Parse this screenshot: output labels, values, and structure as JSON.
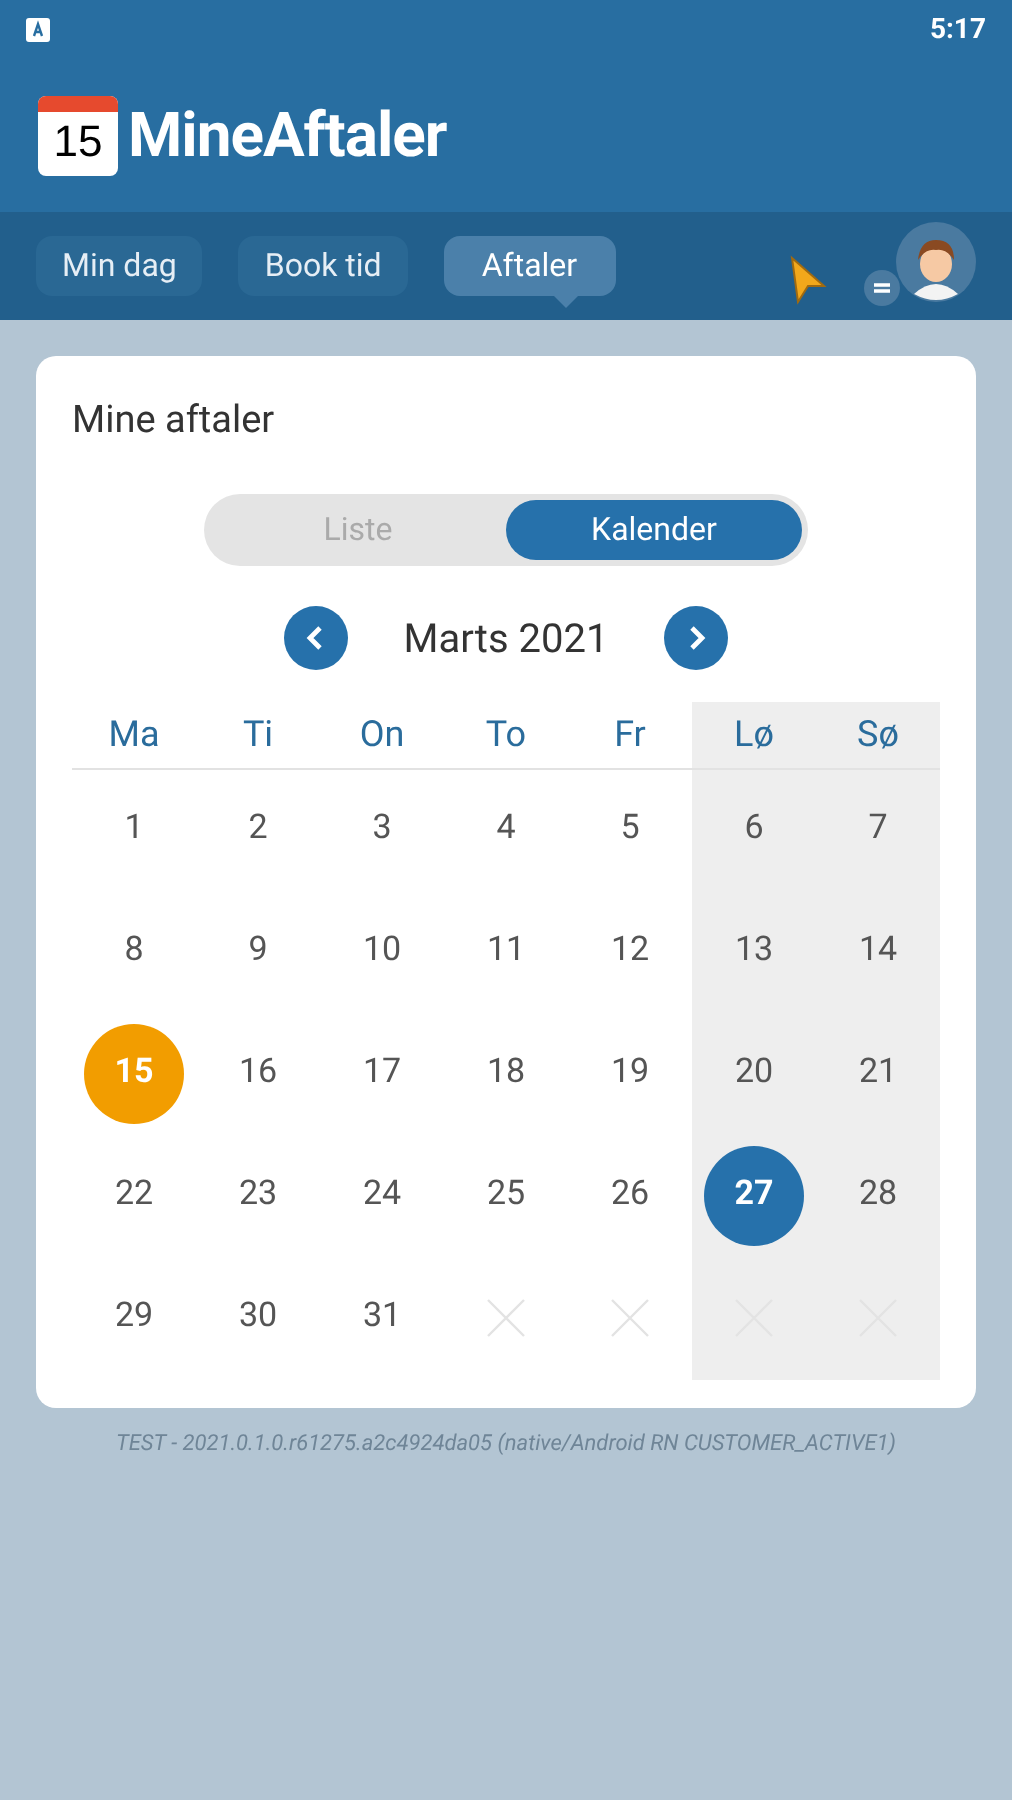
{
  "status_bar": {
    "time": "5:17"
  },
  "app": {
    "logo_day": "15",
    "title": "MineAftaler"
  },
  "tabs": [
    {
      "label": "Min dag",
      "selected": false
    },
    {
      "label": "Book tid",
      "selected": false
    },
    {
      "label": "Aftaler",
      "selected": true
    }
  ],
  "card": {
    "title": "Mine aftaler",
    "view_toggle": [
      {
        "label": "Liste",
        "selected": false
      },
      {
        "label": "Kalender",
        "selected": true
      }
    ],
    "month": "Marts 2021",
    "weekdays": [
      {
        "label": "Ma",
        "weekend": false
      },
      {
        "label": "Ti",
        "weekend": false
      },
      {
        "label": "On",
        "weekend": false
      },
      {
        "label": "To",
        "weekend": false
      },
      {
        "label": "Fr",
        "weekend": false
      },
      {
        "label": "Lø",
        "weekend": true
      },
      {
        "label": "Sø",
        "weekend": true
      }
    ],
    "days": [
      {
        "kind": "day",
        "label": "1"
      },
      {
        "kind": "day",
        "label": "2"
      },
      {
        "kind": "day",
        "label": "3"
      },
      {
        "kind": "day",
        "label": "4"
      },
      {
        "kind": "day",
        "label": "5"
      },
      {
        "kind": "day",
        "label": "6"
      },
      {
        "kind": "day",
        "label": "7"
      },
      {
        "kind": "day",
        "label": "8"
      },
      {
        "kind": "day",
        "label": "9"
      },
      {
        "kind": "day",
        "label": "10"
      },
      {
        "kind": "day",
        "label": "11"
      },
      {
        "kind": "day",
        "label": "12"
      },
      {
        "kind": "day",
        "label": "13"
      },
      {
        "kind": "day",
        "label": "14"
      },
      {
        "kind": "today",
        "label": "15"
      },
      {
        "kind": "day",
        "label": "16"
      },
      {
        "kind": "day",
        "label": "17"
      },
      {
        "kind": "day",
        "label": "18"
      },
      {
        "kind": "day",
        "label": "19"
      },
      {
        "kind": "day",
        "label": "20"
      },
      {
        "kind": "day",
        "label": "21"
      },
      {
        "kind": "day",
        "label": "22"
      },
      {
        "kind": "day",
        "label": "23"
      },
      {
        "kind": "day",
        "label": "24"
      },
      {
        "kind": "day",
        "label": "25"
      },
      {
        "kind": "day",
        "label": "26"
      },
      {
        "kind": "selected",
        "label": "27"
      },
      {
        "kind": "day",
        "label": "28"
      },
      {
        "kind": "day",
        "label": "29"
      },
      {
        "kind": "day",
        "label": "30"
      },
      {
        "kind": "day",
        "label": "31"
      },
      {
        "kind": "empty"
      },
      {
        "kind": "empty"
      },
      {
        "kind": "empty"
      },
      {
        "kind": "empty"
      }
    ]
  },
  "version": "TEST - 2021.0.1.0.r61275.a2c4924da05 (native/Android RN CUSTOMER_ACTIVE1)"
}
